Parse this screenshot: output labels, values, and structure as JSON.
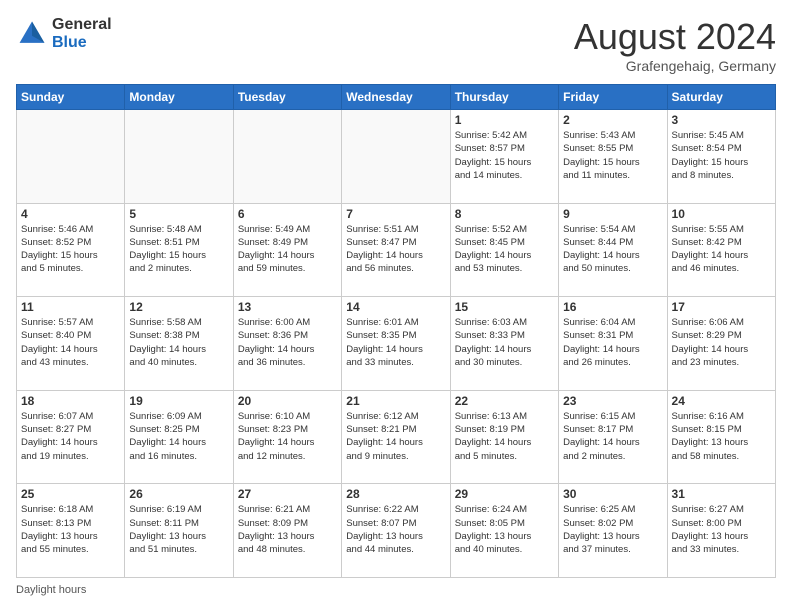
{
  "header": {
    "logo_general": "General",
    "logo_blue": "Blue",
    "month_year": "August 2024",
    "location": "Grafengehaig, Germany"
  },
  "calendar": {
    "days_of_week": [
      "Sunday",
      "Monday",
      "Tuesday",
      "Wednesday",
      "Thursday",
      "Friday",
      "Saturday"
    ],
    "weeks": [
      [
        {
          "day": "",
          "info": ""
        },
        {
          "day": "",
          "info": ""
        },
        {
          "day": "",
          "info": ""
        },
        {
          "day": "",
          "info": ""
        },
        {
          "day": "1",
          "info": "Sunrise: 5:42 AM\nSunset: 8:57 PM\nDaylight: 15 hours\nand 14 minutes."
        },
        {
          "day": "2",
          "info": "Sunrise: 5:43 AM\nSunset: 8:55 PM\nDaylight: 15 hours\nand 11 minutes."
        },
        {
          "day": "3",
          "info": "Sunrise: 5:45 AM\nSunset: 8:54 PM\nDaylight: 15 hours\nand 8 minutes."
        }
      ],
      [
        {
          "day": "4",
          "info": "Sunrise: 5:46 AM\nSunset: 8:52 PM\nDaylight: 15 hours\nand 5 minutes."
        },
        {
          "day": "5",
          "info": "Sunrise: 5:48 AM\nSunset: 8:51 PM\nDaylight: 15 hours\nand 2 minutes."
        },
        {
          "day": "6",
          "info": "Sunrise: 5:49 AM\nSunset: 8:49 PM\nDaylight: 14 hours\nand 59 minutes."
        },
        {
          "day": "7",
          "info": "Sunrise: 5:51 AM\nSunset: 8:47 PM\nDaylight: 14 hours\nand 56 minutes."
        },
        {
          "day": "8",
          "info": "Sunrise: 5:52 AM\nSunset: 8:45 PM\nDaylight: 14 hours\nand 53 minutes."
        },
        {
          "day": "9",
          "info": "Sunrise: 5:54 AM\nSunset: 8:44 PM\nDaylight: 14 hours\nand 50 minutes."
        },
        {
          "day": "10",
          "info": "Sunrise: 5:55 AM\nSunset: 8:42 PM\nDaylight: 14 hours\nand 46 minutes."
        }
      ],
      [
        {
          "day": "11",
          "info": "Sunrise: 5:57 AM\nSunset: 8:40 PM\nDaylight: 14 hours\nand 43 minutes."
        },
        {
          "day": "12",
          "info": "Sunrise: 5:58 AM\nSunset: 8:38 PM\nDaylight: 14 hours\nand 40 minutes."
        },
        {
          "day": "13",
          "info": "Sunrise: 6:00 AM\nSunset: 8:36 PM\nDaylight: 14 hours\nand 36 minutes."
        },
        {
          "day": "14",
          "info": "Sunrise: 6:01 AM\nSunset: 8:35 PM\nDaylight: 14 hours\nand 33 minutes."
        },
        {
          "day": "15",
          "info": "Sunrise: 6:03 AM\nSunset: 8:33 PM\nDaylight: 14 hours\nand 30 minutes."
        },
        {
          "day": "16",
          "info": "Sunrise: 6:04 AM\nSunset: 8:31 PM\nDaylight: 14 hours\nand 26 minutes."
        },
        {
          "day": "17",
          "info": "Sunrise: 6:06 AM\nSunset: 8:29 PM\nDaylight: 14 hours\nand 23 minutes."
        }
      ],
      [
        {
          "day": "18",
          "info": "Sunrise: 6:07 AM\nSunset: 8:27 PM\nDaylight: 14 hours\nand 19 minutes."
        },
        {
          "day": "19",
          "info": "Sunrise: 6:09 AM\nSunset: 8:25 PM\nDaylight: 14 hours\nand 16 minutes."
        },
        {
          "day": "20",
          "info": "Sunrise: 6:10 AM\nSunset: 8:23 PM\nDaylight: 14 hours\nand 12 minutes."
        },
        {
          "day": "21",
          "info": "Sunrise: 6:12 AM\nSunset: 8:21 PM\nDaylight: 14 hours\nand 9 minutes."
        },
        {
          "day": "22",
          "info": "Sunrise: 6:13 AM\nSunset: 8:19 PM\nDaylight: 14 hours\nand 5 minutes."
        },
        {
          "day": "23",
          "info": "Sunrise: 6:15 AM\nSunset: 8:17 PM\nDaylight: 14 hours\nand 2 minutes."
        },
        {
          "day": "24",
          "info": "Sunrise: 6:16 AM\nSunset: 8:15 PM\nDaylight: 13 hours\nand 58 minutes."
        }
      ],
      [
        {
          "day": "25",
          "info": "Sunrise: 6:18 AM\nSunset: 8:13 PM\nDaylight: 13 hours\nand 55 minutes."
        },
        {
          "day": "26",
          "info": "Sunrise: 6:19 AM\nSunset: 8:11 PM\nDaylight: 13 hours\nand 51 minutes."
        },
        {
          "day": "27",
          "info": "Sunrise: 6:21 AM\nSunset: 8:09 PM\nDaylight: 13 hours\nand 48 minutes."
        },
        {
          "day": "28",
          "info": "Sunrise: 6:22 AM\nSunset: 8:07 PM\nDaylight: 13 hours\nand 44 minutes."
        },
        {
          "day": "29",
          "info": "Sunrise: 6:24 AM\nSunset: 8:05 PM\nDaylight: 13 hours\nand 40 minutes."
        },
        {
          "day": "30",
          "info": "Sunrise: 6:25 AM\nSunset: 8:02 PM\nDaylight: 13 hours\nand 37 minutes."
        },
        {
          "day": "31",
          "info": "Sunrise: 6:27 AM\nSunset: 8:00 PM\nDaylight: 13 hours\nand 33 minutes."
        }
      ]
    ]
  },
  "footer": {
    "text": "Daylight hours"
  }
}
